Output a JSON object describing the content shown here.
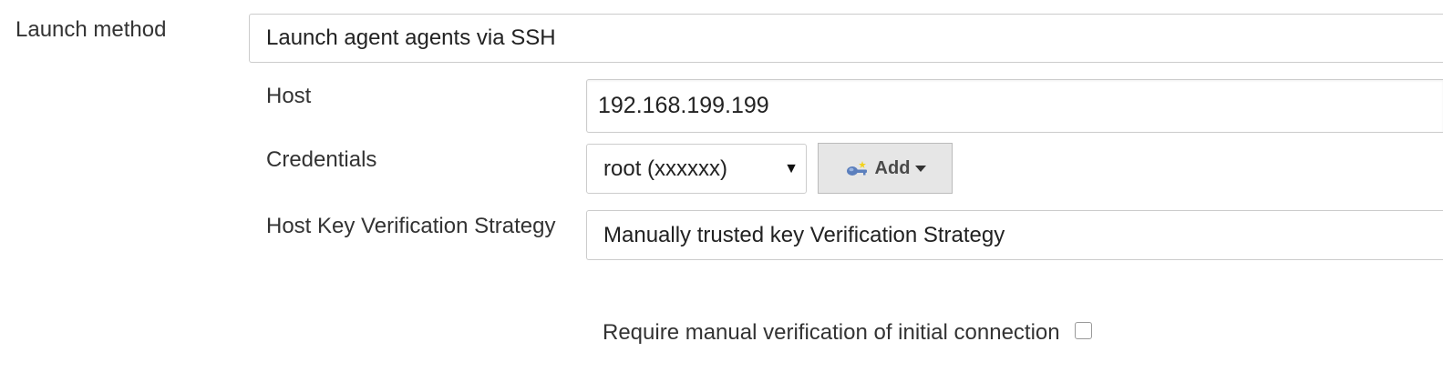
{
  "launch_method": {
    "label": "Launch method",
    "selected": "Launch agent agents via SSH"
  },
  "host": {
    "label": "Host",
    "value": "192.168.199.199"
  },
  "credentials": {
    "label": "Credentials",
    "selected": "root (xxxxxx)",
    "caret": "▼",
    "add_button_label": "Add",
    "add_icon": "key-icon"
  },
  "host_key_verification": {
    "label": "Host Key Verification Strategy",
    "selected": "Manually trusted key Verification Strategy",
    "require_manual_label": "Require manual verification of initial connection",
    "require_manual_checked": false
  },
  "colors": {
    "text": "#333333",
    "border": "#cccccc",
    "button_bg": "#e6e6e6",
    "key_blue": "#5b7fbd",
    "key_yellow": "#f3d31c"
  }
}
